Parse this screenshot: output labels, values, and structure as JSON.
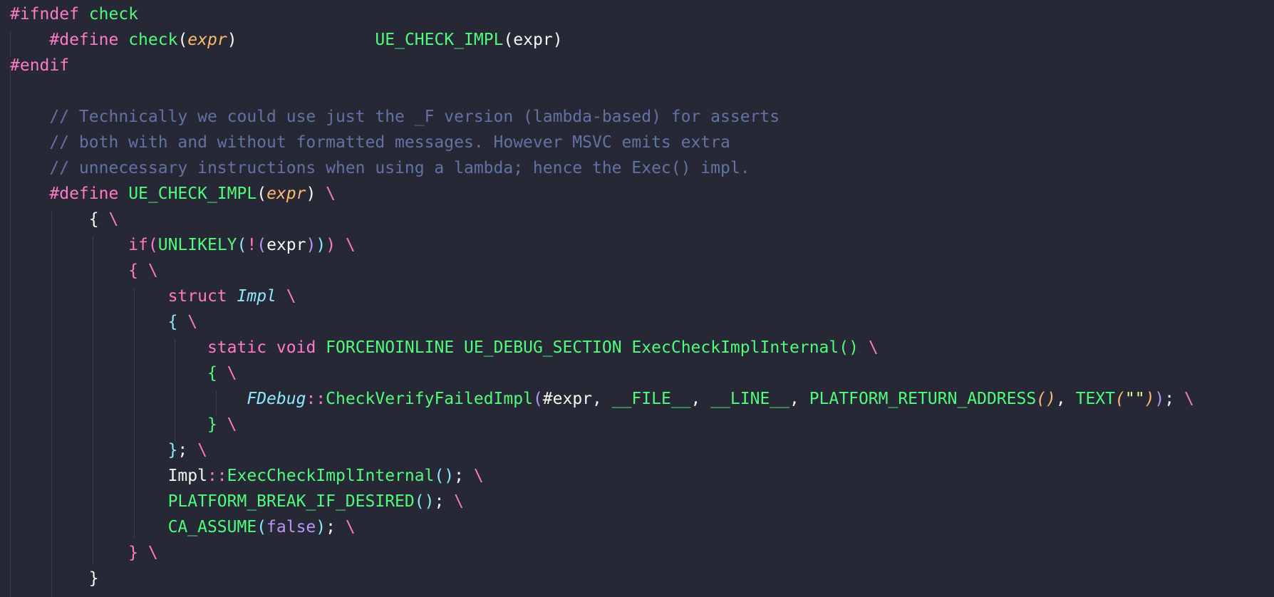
{
  "editor": {
    "lines": [
      {
        "indent": 0,
        "tokens": [
          {
            "t": "#ifndef",
            "c": "pp"
          },
          {
            "t": " "
          },
          {
            "t": "check",
            "c": "fn"
          }
        ]
      },
      {
        "indent": 4,
        "tokens": [
          {
            "t": "#define",
            "c": "pp"
          },
          {
            "t": " "
          },
          {
            "t": "check",
            "c": "fn"
          },
          {
            "t": "(",
            "c": "plain"
          },
          {
            "t": "expr",
            "c": "param"
          },
          {
            "t": ")",
            "c": "plain"
          },
          {
            "t": "              "
          },
          {
            "t": "UE_CHECK_IMPL",
            "c": "fn"
          },
          {
            "t": "(",
            "c": "plain"
          },
          {
            "t": "expr",
            "c": "plain"
          },
          {
            "t": ")",
            "c": "plain"
          }
        ]
      },
      {
        "indent": 0,
        "tokens": [
          {
            "t": "#endif",
            "c": "pp"
          }
        ]
      },
      {
        "indent": 0,
        "tokens": []
      },
      {
        "indent": 4,
        "tokens": [
          {
            "t": "// Technically we could use just the _F version (lambda-based) for asserts",
            "c": "comment"
          }
        ]
      },
      {
        "indent": 4,
        "tokens": [
          {
            "t": "// both with and without formatted messages. However MSVC emits extra",
            "c": "comment"
          }
        ]
      },
      {
        "indent": 4,
        "tokens": [
          {
            "t": "// unnecessary instructions when using a lambda; hence the Exec() impl.",
            "c": "comment"
          }
        ]
      },
      {
        "indent": 4,
        "tokens": [
          {
            "t": "#define",
            "c": "pp"
          },
          {
            "t": " "
          },
          {
            "t": "UE_CHECK_IMPL",
            "c": "fn"
          },
          {
            "t": "(",
            "c": "plain"
          },
          {
            "t": "expr",
            "c": "param"
          },
          {
            "t": ")",
            "c": "plain"
          },
          {
            "t": " "
          },
          {
            "t": "\\",
            "c": "cont"
          }
        ]
      },
      {
        "indent": 8,
        "tokens": [
          {
            "t": "{",
            "c": "plain"
          },
          {
            "t": " "
          },
          {
            "t": "\\",
            "c": "cont"
          }
        ]
      },
      {
        "indent": 12,
        "tokens": [
          {
            "t": "if",
            "c": "kw"
          },
          {
            "t": "(",
            "c": "punct"
          },
          {
            "t": "UNLIKELY",
            "c": "fn"
          },
          {
            "t": "(",
            "c": "p2"
          },
          {
            "t": "!",
            "c": "punct"
          },
          {
            "t": "(",
            "c": "p3"
          },
          {
            "t": "expr",
            "c": "plain"
          },
          {
            "t": ")",
            "c": "p3"
          },
          {
            "t": ")",
            "c": "p2"
          },
          {
            "t": ")",
            "c": "punct"
          },
          {
            "t": " "
          },
          {
            "t": "\\",
            "c": "cont"
          }
        ]
      },
      {
        "indent": 12,
        "tokens": [
          {
            "t": "{",
            "c": "punct"
          },
          {
            "t": " "
          },
          {
            "t": "\\",
            "c": "cont"
          }
        ]
      },
      {
        "indent": 16,
        "tokens": [
          {
            "t": "struct",
            "c": "kw"
          },
          {
            "t": " "
          },
          {
            "t": "Impl",
            "c": "type"
          },
          {
            "t": " "
          },
          {
            "t": "\\",
            "c": "cont"
          }
        ]
      },
      {
        "indent": 16,
        "tokens": [
          {
            "t": "{",
            "c": "p2"
          },
          {
            "t": " "
          },
          {
            "t": "\\",
            "c": "cont"
          }
        ]
      },
      {
        "indent": 20,
        "tokens": [
          {
            "t": "static",
            "c": "kw"
          },
          {
            "t": " "
          },
          {
            "t": "void",
            "c": "kw"
          },
          {
            "t": " "
          },
          {
            "t": "FORCENOINLINE",
            "c": "fn"
          },
          {
            "t": " "
          },
          {
            "t": "UE_DEBUG_SECTION",
            "c": "fn"
          },
          {
            "t": " "
          },
          {
            "t": "ExecCheckImplInternal",
            "c": "fn"
          },
          {
            "t": "()",
            "c": "fn"
          },
          {
            "t": " "
          },
          {
            "t": "\\",
            "c": "cont"
          }
        ]
      },
      {
        "indent": 20,
        "tokens": [
          {
            "t": "{",
            "c": "fn"
          },
          {
            "t": " "
          },
          {
            "t": "\\",
            "c": "cont"
          }
        ]
      },
      {
        "indent": 24,
        "tokens": [
          {
            "t": "FDebug",
            "c": "type"
          },
          {
            "t": "::",
            "c": "punct"
          },
          {
            "t": "CheckVerifyFailedImpl",
            "c": "fn"
          },
          {
            "t": "(",
            "c": "p3"
          },
          {
            "t": "#expr, ",
            "c": "plain"
          },
          {
            "t": "__FILE__",
            "c": "fn"
          },
          {
            "t": ", ",
            "c": "plain"
          },
          {
            "t": "__LINE__",
            "c": "fn"
          },
          {
            "t": ", ",
            "c": "plain"
          },
          {
            "t": "PLATFORM_RETURN_ADDRESS",
            "c": "fn"
          },
          {
            "t": "()",
            "c": "param"
          },
          {
            "t": ", ",
            "c": "plain"
          },
          {
            "t": "TEXT",
            "c": "fn"
          },
          {
            "t": "(",
            "c": "param"
          },
          {
            "t": "\"\"",
            "c": "str"
          },
          {
            "t": ")",
            "c": "param"
          },
          {
            "t": ")",
            "c": "p3"
          },
          {
            "t": ";",
            "c": "plain"
          },
          {
            "t": " "
          },
          {
            "t": "\\",
            "c": "cont"
          }
        ]
      },
      {
        "indent": 20,
        "tokens": [
          {
            "t": "}",
            "c": "fn"
          },
          {
            "t": " "
          },
          {
            "t": "\\",
            "c": "cont"
          }
        ]
      },
      {
        "indent": 16,
        "tokens": [
          {
            "t": "}",
            "c": "p2"
          },
          {
            "t": ";",
            "c": "plain"
          },
          {
            "t": " "
          },
          {
            "t": "\\",
            "c": "cont"
          }
        ]
      },
      {
        "indent": 16,
        "tokens": [
          {
            "t": "Impl",
            "c": "plain"
          },
          {
            "t": "::",
            "c": "punct"
          },
          {
            "t": "ExecCheckImplInternal",
            "c": "fn"
          },
          {
            "t": "()",
            "c": "p2"
          },
          {
            "t": ";",
            "c": "plain"
          },
          {
            "t": " "
          },
          {
            "t": "\\",
            "c": "cont"
          }
        ]
      },
      {
        "indent": 16,
        "tokens": [
          {
            "t": "PLATFORM_BREAK_IF_DESIRED",
            "c": "fn"
          },
          {
            "t": "()",
            "c": "p2"
          },
          {
            "t": ";",
            "c": "plain"
          },
          {
            "t": " "
          },
          {
            "t": "\\",
            "c": "cont"
          }
        ]
      },
      {
        "indent": 16,
        "tokens": [
          {
            "t": "CA_ASSUME",
            "c": "fn"
          },
          {
            "t": "(",
            "c": "p2"
          },
          {
            "t": "false",
            "c": "const"
          },
          {
            "t": ")",
            "c": "p2"
          },
          {
            "t": ";",
            "c": "plain"
          },
          {
            "t": " "
          },
          {
            "t": "\\",
            "c": "cont"
          }
        ]
      },
      {
        "indent": 12,
        "tokens": [
          {
            "t": "}",
            "c": "punct"
          },
          {
            "t": " "
          },
          {
            "t": "\\",
            "c": "cont"
          }
        ]
      },
      {
        "indent": 8,
        "tokens": [
          {
            "t": "}",
            "c": "plain"
          }
        ]
      }
    ]
  },
  "colors": {
    "background": "#262935",
    "preprocessor": "#ff79c6",
    "function": "#50fa7b",
    "parameter": "#ffb86c",
    "comment": "#6272a4",
    "type": "#8be9fd",
    "constant": "#bd93f9"
  }
}
